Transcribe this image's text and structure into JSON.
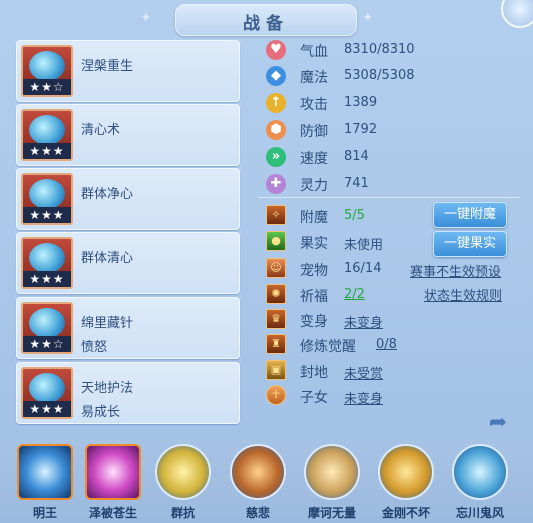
{
  "title": "战备",
  "skills": [
    {
      "name": "涅槃重生",
      "sub": "",
      "stars": "★★☆"
    },
    {
      "name": "清心术",
      "sub": "",
      "stars": "★★★"
    },
    {
      "name": "群体净心",
      "sub": "",
      "stars": "★★★"
    },
    {
      "name": "群体清心",
      "sub": "",
      "stars": "★★★"
    },
    {
      "name": "绵里藏针",
      "sub": "愤怒",
      "stars": "★★☆"
    },
    {
      "name": "天地护法",
      "sub": "易成长",
      "stars": "★★★"
    }
  ],
  "stats": [
    {
      "label": "气血",
      "value": "8310/8310",
      "icon": "heart-icon",
      "color": "#e56e7a"
    },
    {
      "label": "魔法",
      "value": "5308/5308",
      "icon": "mana-icon",
      "color": "#3d8fe0"
    },
    {
      "label": "攻击",
      "value": "1389",
      "icon": "attack-icon",
      "color": "#e9b22c"
    },
    {
      "label": "防御",
      "value": "1792",
      "icon": "defense-icon",
      "color": "#ee8f4d"
    },
    {
      "label": "速度",
      "value": "814",
      "icon": "speed-icon",
      "color": "#2fbf7a"
    },
    {
      "label": "灵力",
      "value": "741",
      "icon": "spirit-icon",
      "color": "#b484d8"
    }
  ],
  "equip": [
    {
      "label": "附魔",
      "value": "5/5",
      "style": "green"
    },
    {
      "label": "果实",
      "value": "未使用",
      "style": ""
    },
    {
      "label": "宠物",
      "value": "16/14",
      "style": ""
    },
    {
      "label": "祈福",
      "value": "2/2",
      "style": "green ul"
    },
    {
      "label": "变身",
      "value": "未变身",
      "style": "ul"
    },
    {
      "label": "修炼觉醒",
      "value": "0/8",
      "style": "ul"
    },
    {
      "label": "封地",
      "value": "未受赏",
      "style": "ul"
    },
    {
      "label": "子女",
      "value": "未变身",
      "style": "ul"
    }
  ],
  "buttons": {
    "enchant": "一键附魔",
    "fruit": "一键果实"
  },
  "links": {
    "event_preset": "赛事不生效预设",
    "status_rules": "状态生效规则"
  },
  "bottom": [
    {
      "label": "明王",
      "active": true,
      "variant": "blue"
    },
    {
      "label": "泽被苍生",
      "active": true,
      "variant": "pink"
    },
    {
      "label": "群抗",
      "active": false
    },
    {
      "label": "慈悲",
      "active": false
    },
    {
      "label": "摩诃无量",
      "active": false
    },
    {
      "label": "金刚不坏",
      "active": false
    },
    {
      "label": "忘川鬼风",
      "active": false
    }
  ]
}
